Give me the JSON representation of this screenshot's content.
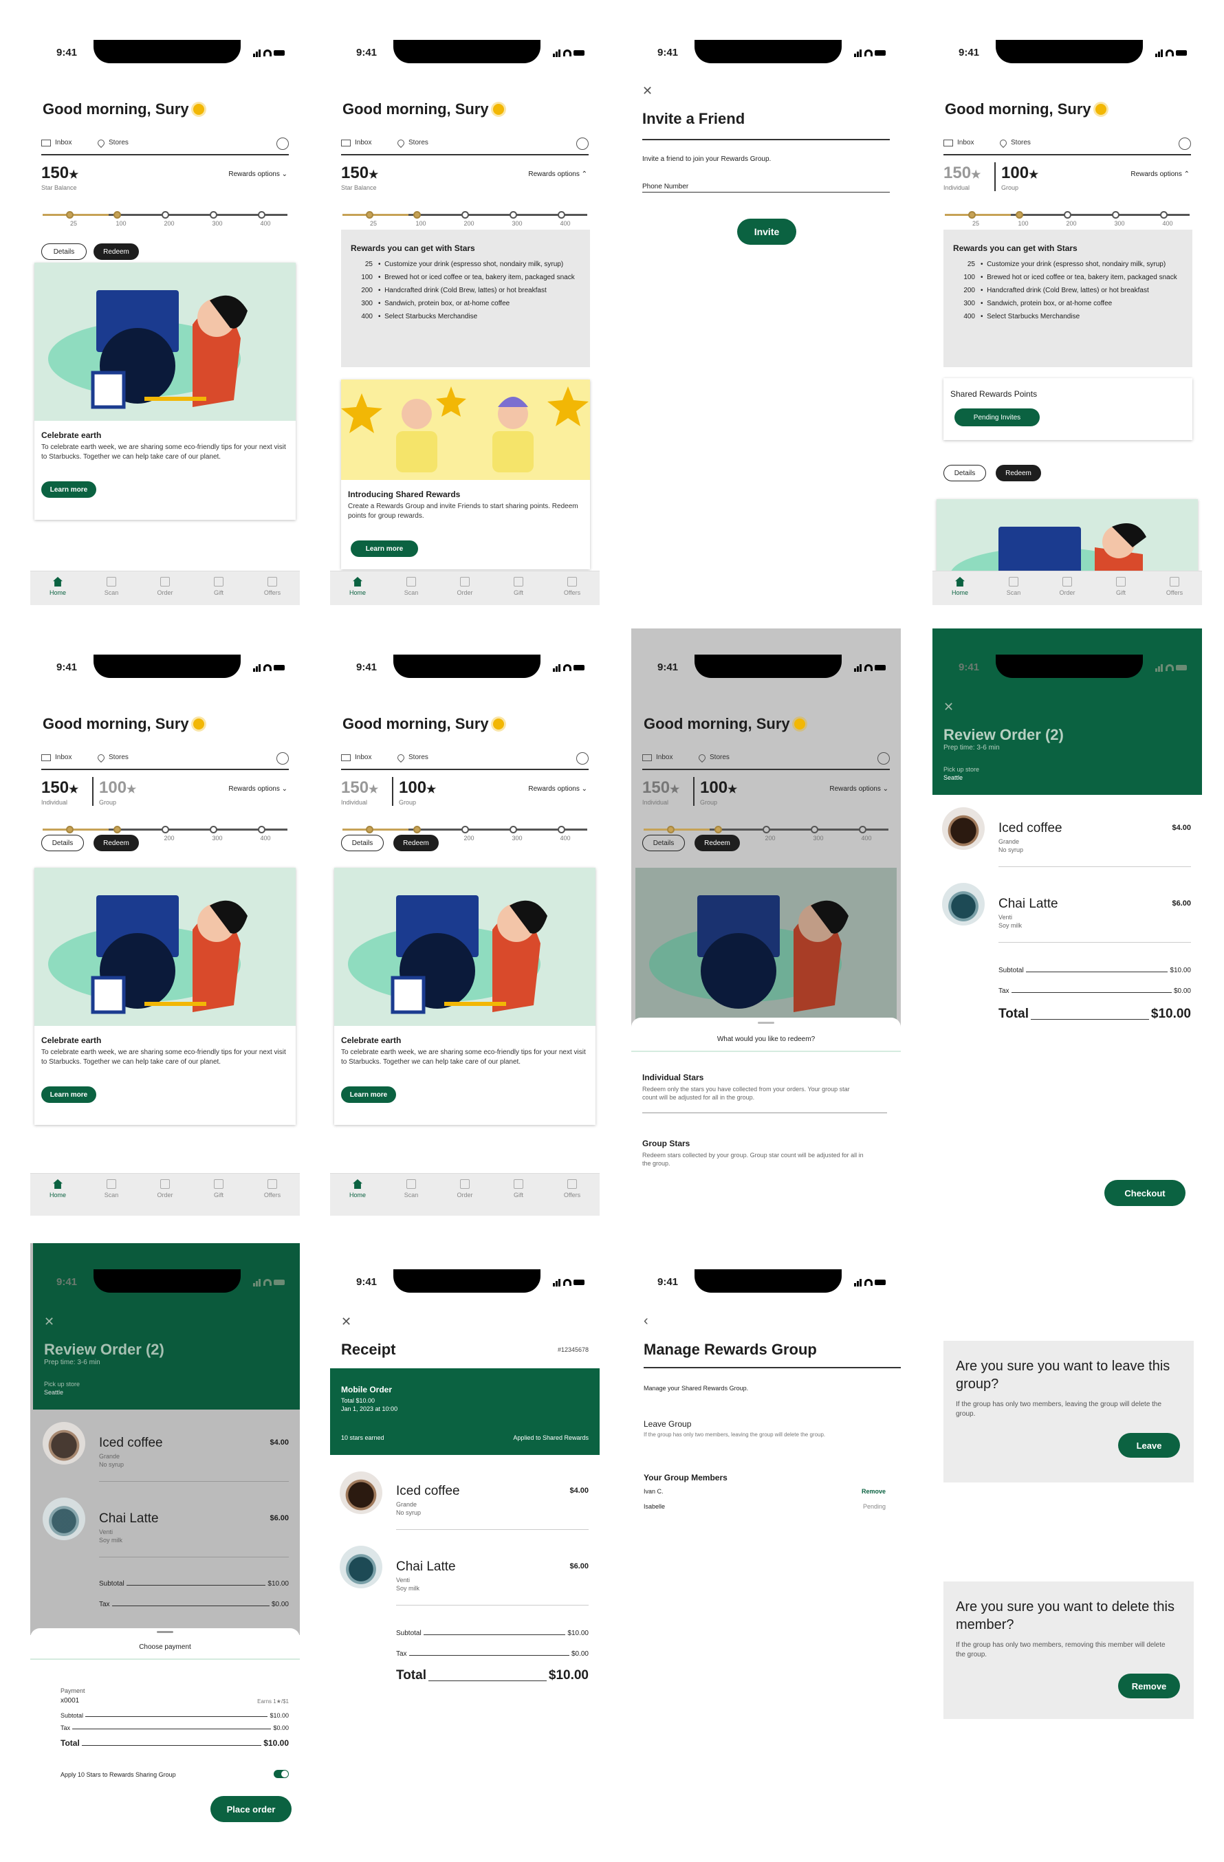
{
  "status": {
    "time": "9:41"
  },
  "home": {
    "greeting": "Good morning, Sury",
    "inbox": "Inbox",
    "stores": "Stores",
    "stars": "150",
    "star_balance": "Star Balance",
    "group_stars": "100",
    "individual": "Individual",
    "group": "Group",
    "rewards_options": "Rewards options",
    "ticks": [
      "25",
      "100",
      "200",
      "300",
      "400"
    ],
    "details": "Details",
    "redeem": "Redeem",
    "card_title": "Celebrate earth",
    "card_body": "To celebrate earth week, we are sharing some eco-friendly tips for your next visit to Starbucks. Together we can help take care of our planet.",
    "learn_more": "Learn more"
  },
  "tabs": [
    "Home",
    "Scan",
    "Order",
    "Gift",
    "Offers"
  ],
  "rewards": {
    "title": "Rewards you can get with Stars",
    "items": [
      {
        "n": "25",
        "t": "Customize your drink (espresso shot, nondairy milk, syrup)"
      },
      {
        "n": "100",
        "t": "Brewed hot or iced coffee or tea, bakery item, packaged snack"
      },
      {
        "n": "200",
        "t": "Handcrafted drink (Cold Brew, lattes) or hot breakfast"
      },
      {
        "n": "300",
        "t": "Sandwich, protein box, or at-home coffee"
      },
      {
        "n": "400",
        "t": "Select Starbucks Merchandise"
      }
    ]
  },
  "shared_card": {
    "title": "Introducing Shared Rewards",
    "body": "Create a Rewards Group and invite Friends to start sharing points. Redeem points for group rewards.",
    "btn": "Learn more"
  },
  "shared_points": {
    "title": "Shared Rewards Points",
    "btn": "Pending Invites"
  },
  "invite": {
    "title": "Invite a Friend",
    "desc": "Invite a friend to join your Rewards Group.",
    "field": "Phone Number",
    "btn": "Invite"
  },
  "redeem_sheet": {
    "question": "What would you like to redeem?",
    "ind_title": "Individual Stars",
    "ind_body": "Redeem only the stars you have collected from your orders. Your group star count will be adjusted for all in the group.",
    "grp_title": "Group Stars",
    "grp_body": "Redeem stars collected by your group. Group star count will be adjusted for all in the group."
  },
  "review": {
    "title": "Review Order (2)",
    "prep": "Prep time: 3-6 min",
    "pickup": "Pick up store",
    "store": "Seattle",
    "items": [
      {
        "name": "Iced coffee",
        "price": "$4.00",
        "l1": "Grande",
        "l2": "No syrup"
      },
      {
        "name": "Chai Latte",
        "price": "$6.00",
        "l1": "Venti",
        "l2": "Soy milk"
      }
    ],
    "subtotal_l": "Subtotal",
    "subtotal": "$10.00",
    "tax_l": "Tax",
    "tax": "$0.00",
    "total_l": "Total",
    "total": "$10.00",
    "checkout": "Checkout"
  },
  "payment": {
    "title": "Choose payment",
    "payment_l": "Payment",
    "card": "x0001",
    "earns": "Earns 1★/$1",
    "apply": "Apply 10 Stars to Rewards Sharing Group",
    "btn": "Place order"
  },
  "receipt": {
    "title": "Receipt",
    "order_no": "#12345678",
    "mo": "Mobile Order",
    "total_line": "Total $10.00",
    "date": "Jan 1, 2023 at 10:00",
    "earned": "10 stars earned",
    "applied": "Applied to Shared Rewards"
  },
  "manage": {
    "title": "Manage Rewards Group",
    "desc": "Manage your Shared Rewards Group.",
    "leave_t": "Leave Group",
    "leave_d": "If the group has only two members, leaving the group will delete the group.",
    "members_t": "Your Group Members",
    "m1": "Ivan C.",
    "m1a": "Remove",
    "m2": "Isabelle",
    "m2a": "Pending"
  },
  "confirm_leave": {
    "q": "Are you sure you want to leave this group?",
    "d": "If the group has only two members, leaving the group will delete the group.",
    "btn": "Leave"
  },
  "confirm_remove": {
    "q": "Are you sure you want to delete this member?",
    "d": "If the group has only two members, removing this member will delete the group.",
    "btn": "Remove"
  },
  "colors": {
    "green": "#0b6241",
    "gold": "#c6a256"
  }
}
